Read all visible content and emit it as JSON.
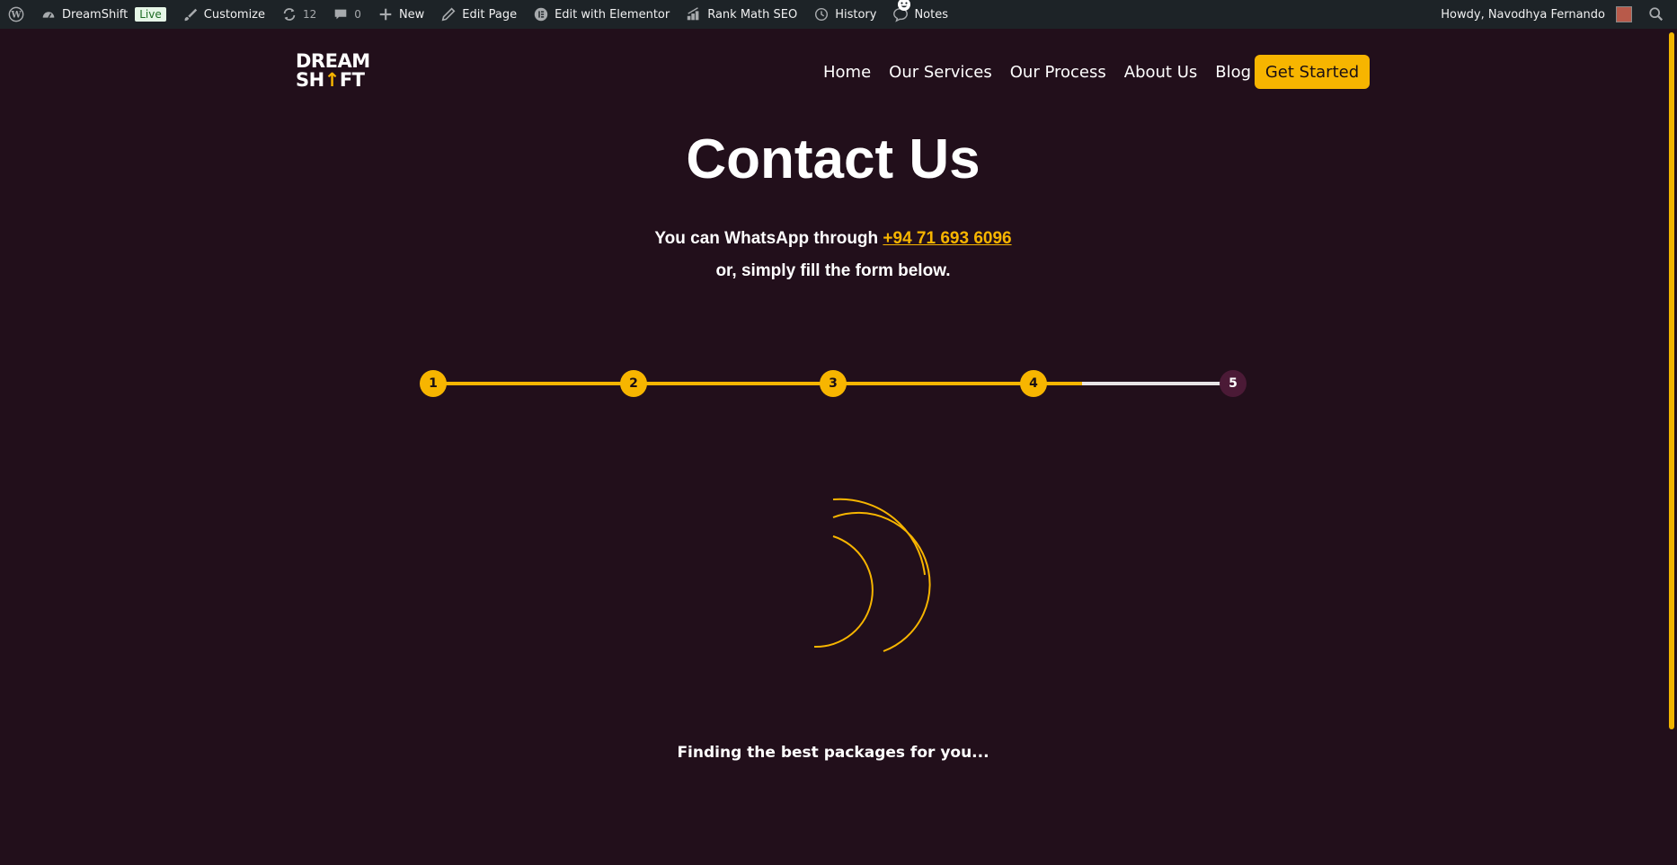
{
  "admin_bar": {
    "site_name": "DreamShift",
    "live_badge": "Live",
    "customize": "Customize",
    "updates_count": "12",
    "comments_count": "0",
    "new": "New",
    "edit_page": "Edit Page",
    "edit_elementor": "Edit with Elementor",
    "rank_math": "Rank Math SEO",
    "history": "History",
    "notes": "Notes",
    "howdy": "Howdy, Navodhya Fernando"
  },
  "header": {
    "logo_line1": "DREAM",
    "logo_line2_a": "SH",
    "logo_line2_arrow": "↑",
    "logo_line2_b": "FT",
    "nav": [
      "Home",
      "Our Services",
      "Our Process",
      "About Us",
      "Blog"
    ],
    "cta": "Get Started"
  },
  "main": {
    "title": "Contact Us",
    "whatsapp_prefix": "You can WhatsApp through ",
    "phone": "+94 71 693 6096",
    "subtitle_line2": "or, simply fill the form below.",
    "steps": [
      "1",
      "2",
      "3",
      "4",
      "5"
    ],
    "current_step": 4,
    "loading_text": "Finding the best packages for you..."
  },
  "colors": {
    "background": "#220f1b",
    "accent": "#f7b500",
    "admin_bar": "#1d2327",
    "pending_step": "#4b1a36"
  }
}
